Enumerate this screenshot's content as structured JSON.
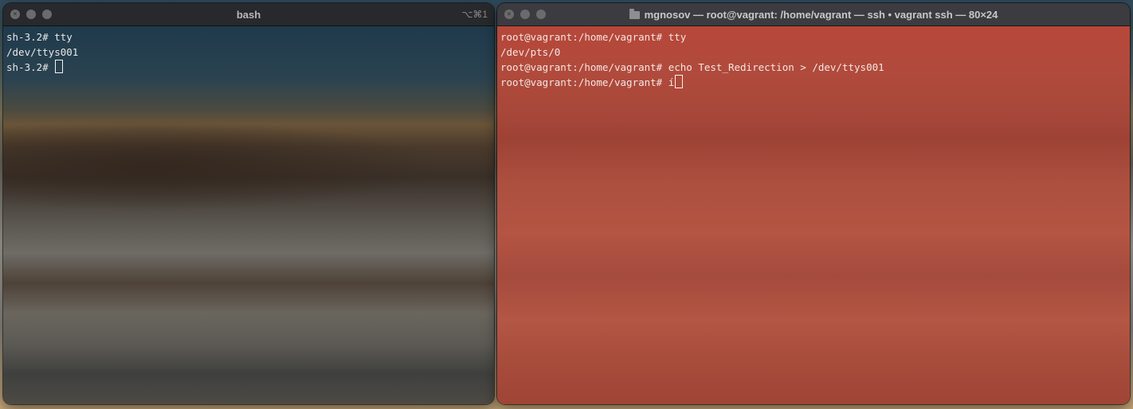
{
  "left_window": {
    "title": "bash",
    "shortcut": "⌥⌘1",
    "lines": [
      "sh-3.2# tty",
      "/dev/ttys001",
      "sh-3.2# "
    ]
  },
  "right_window": {
    "title": "mgnosov — root@vagrant: /home/vagrant — ssh • vagrant ssh — 80×24",
    "lines": [
      "root@vagrant:/home/vagrant# tty",
      "/dev/pts/0",
      "root@vagrant:/home/vagrant# echo Test_Redirection > /dev/ttys001",
      "root@vagrant:/home/vagrant# í"
    ]
  },
  "icons": {
    "close": "close-icon",
    "minimize": "minimize-icon",
    "zoom": "zoom-icon",
    "folder": "folder-icon"
  },
  "colors": {
    "left_text": "#e8e8e8",
    "right_background": "#b24a3c",
    "titlebar": "#262628"
  }
}
